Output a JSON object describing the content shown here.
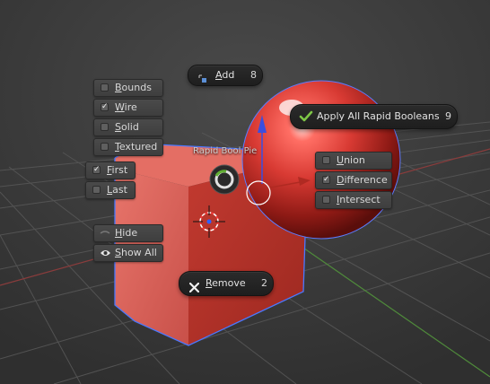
{
  "pie": {
    "title": "Rapid Bool Pie",
    "add": {
      "label": "Add",
      "shortcut": "8"
    },
    "apply_all": {
      "label": "Apply All Rapid Booleans",
      "shortcut": "9"
    },
    "remove": {
      "label": "Remove",
      "shortcut": "2"
    }
  },
  "display_options": [
    {
      "label": "Bounds",
      "checked": false
    },
    {
      "label": "Wire",
      "checked": true
    },
    {
      "label": "Solid",
      "checked": false
    },
    {
      "label": "Textured",
      "checked": false
    }
  ],
  "range_options": [
    {
      "label": "First",
      "checked": true
    },
    {
      "label": "Last",
      "checked": false
    }
  ],
  "visibility": {
    "hide": "Hide",
    "show_all": "Show All"
  },
  "operations": [
    {
      "label": "Union",
      "checked": false
    },
    {
      "label": "Difference",
      "checked": true
    },
    {
      "label": "Intersect",
      "checked": false
    }
  ],
  "colors": {
    "background": "#393939",
    "object_red": "#c8403a",
    "selection_blue": "#4a78ff",
    "check_green": "#7ec646"
  }
}
